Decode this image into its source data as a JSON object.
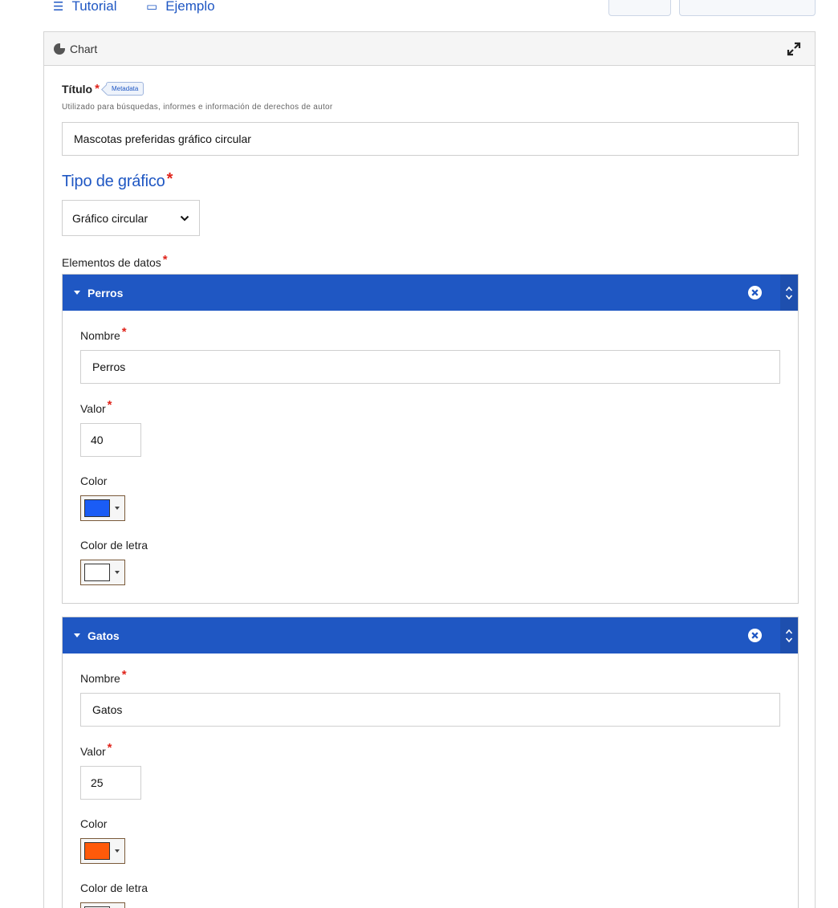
{
  "top_links": {
    "tutorial_label": "Tutorial",
    "ejemplo_label": "Ejemplo"
  },
  "panel": {
    "title": "Chart",
    "titulo_label": "Título",
    "metadata_tag": "Metadata",
    "titulo_help": "Utilizado para búsquedas, informes e información de derechos de autor",
    "titulo_value": "Mascotas preferidas gráfico circular",
    "tipo_label": "Tipo de gráfico",
    "tipo_value": "Gráfico circular",
    "elementos_label": "Elementos de datos"
  },
  "labels": {
    "nombre": "Nombre",
    "valor": "Valor",
    "color": "Color",
    "color_letra": "Color de letra"
  },
  "items": [
    {
      "header": "Perros",
      "nombre": "Perros",
      "valor": "40",
      "color": "#1a5cf5",
      "font_color": "#ffffff"
    },
    {
      "header": "Gatos",
      "nombre": "Gatos",
      "valor": "25",
      "color": "#ff5a0a",
      "font_color": "#ffffff"
    }
  ],
  "colors": {
    "accent": "#1f57c3",
    "required": "#e0241b"
  }
}
